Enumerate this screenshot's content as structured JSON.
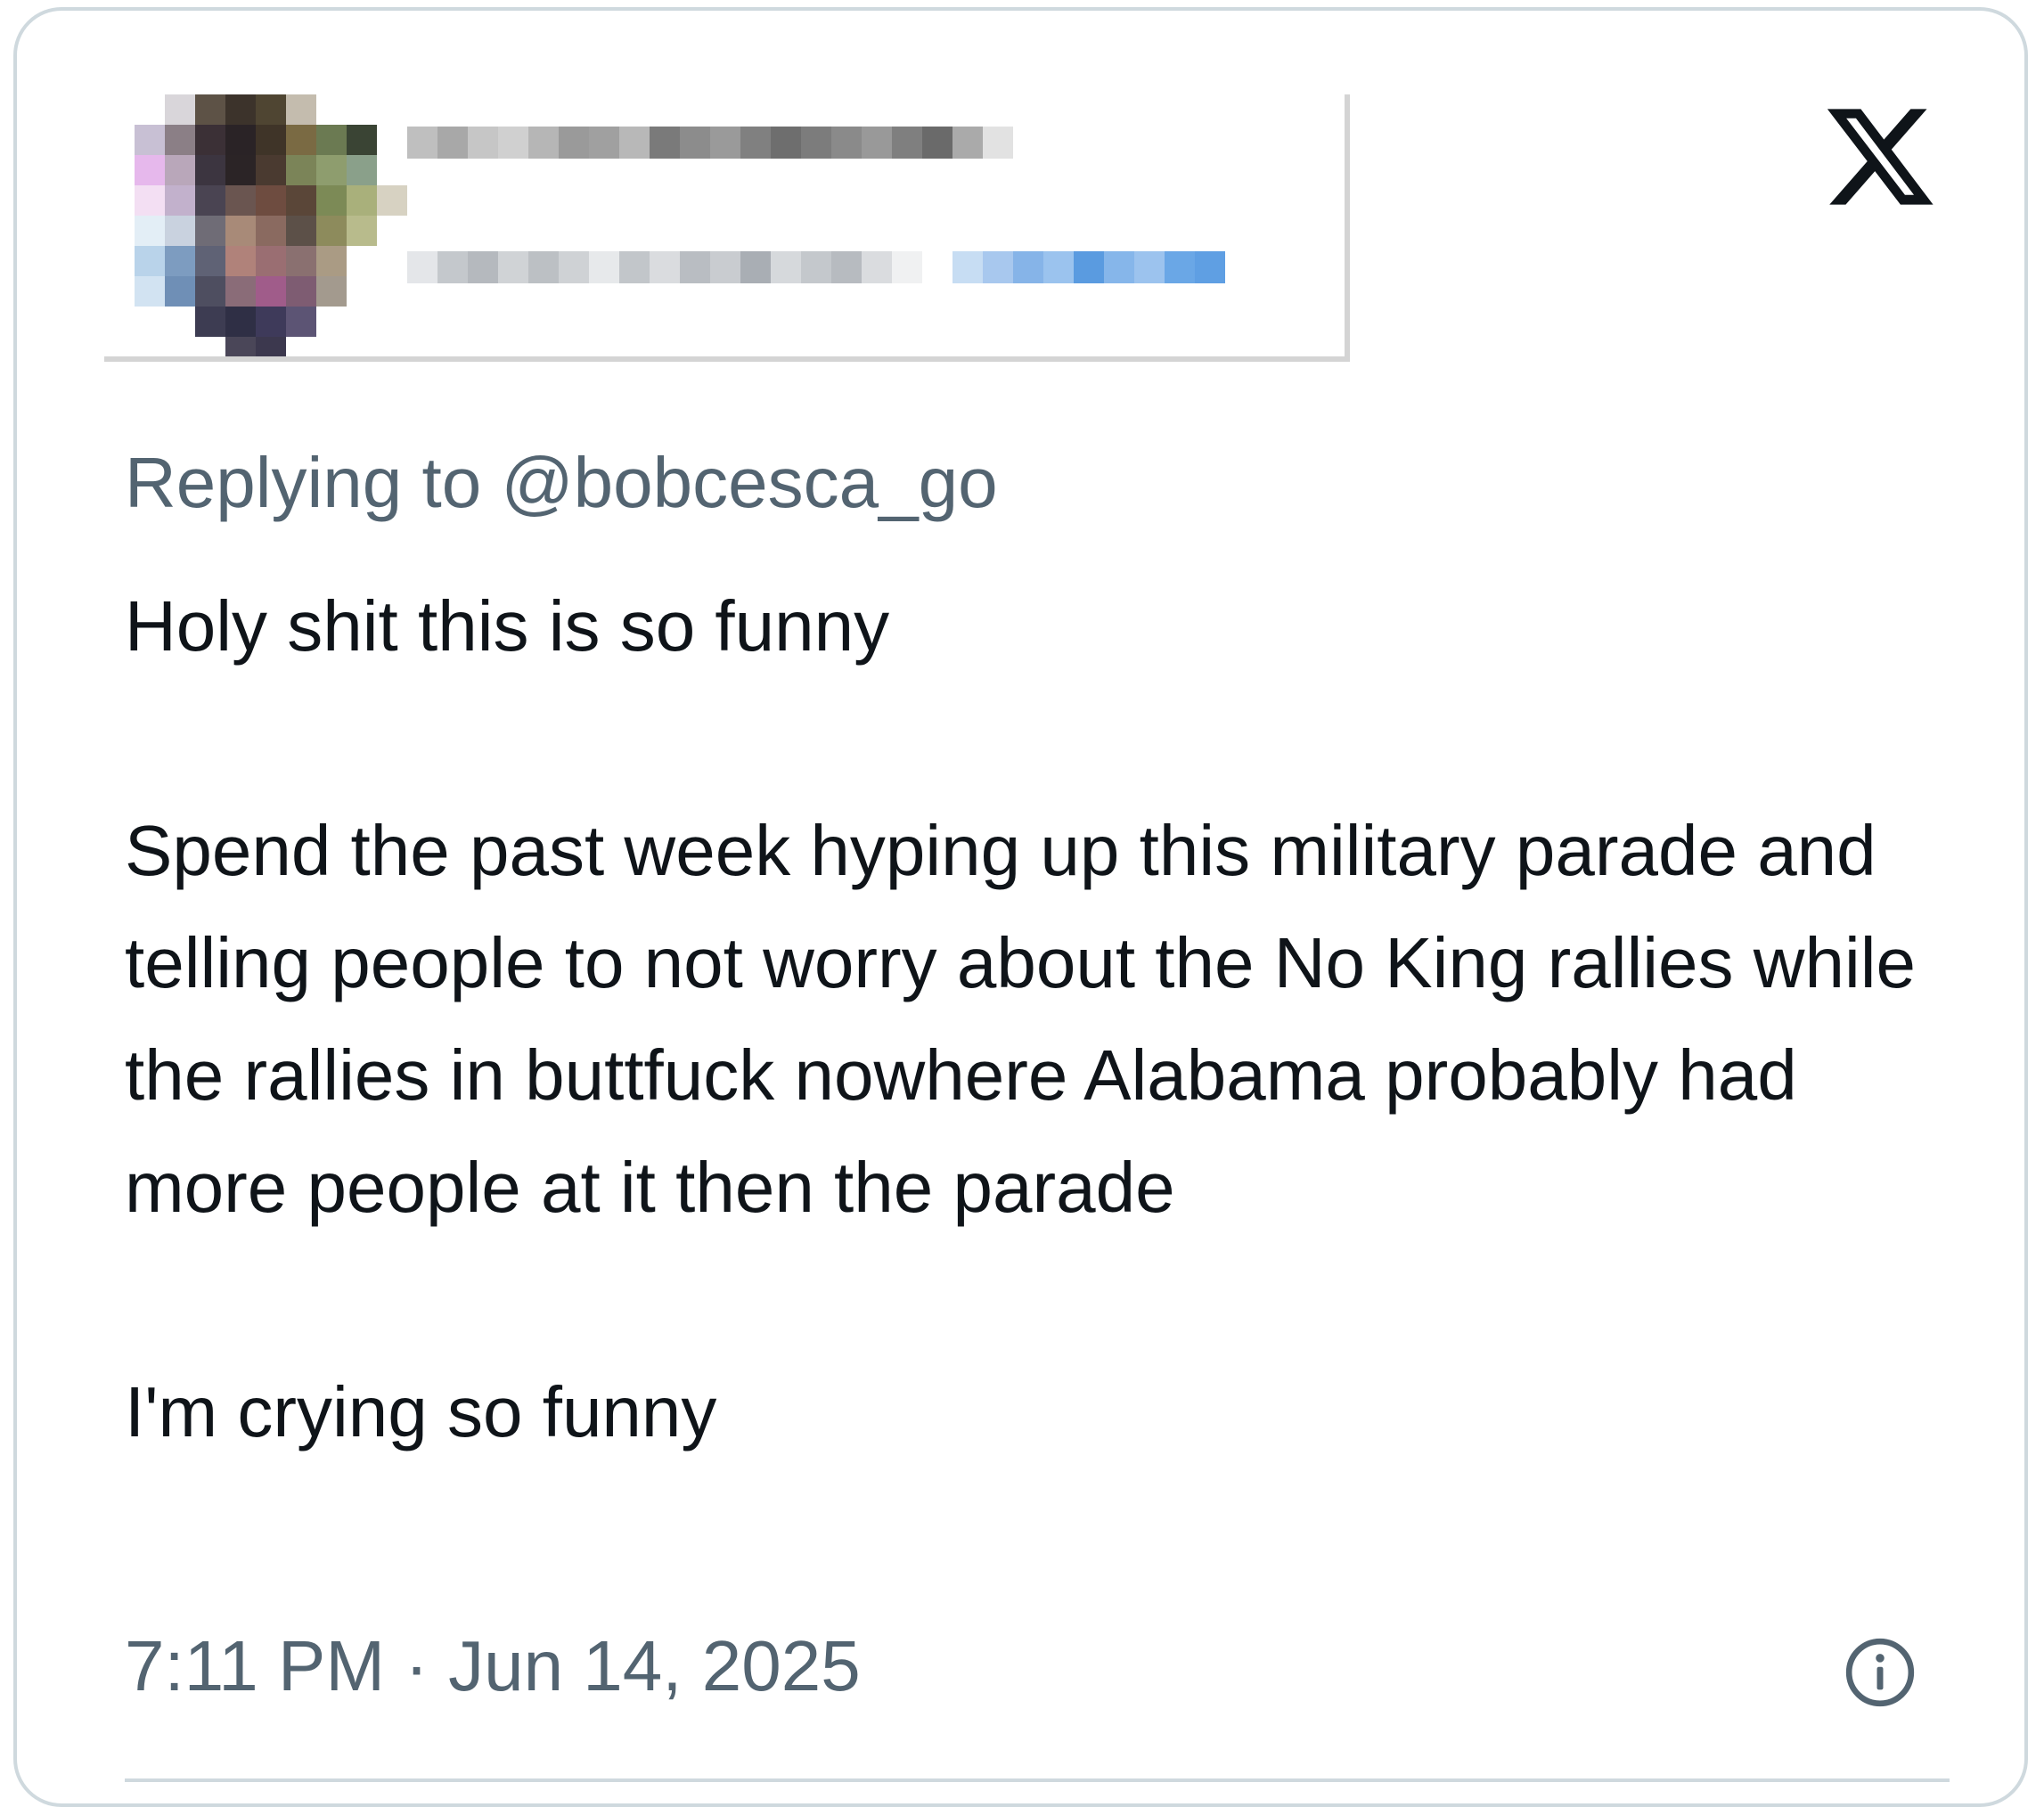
{
  "tweet": {
    "replying_to": "Replying to @bobcesca_go",
    "paragraphs": [
      "Holy shit this is so funny",
      "Spend the past week hyping up this military parade and telling people to not worry about the No King rallies while the rallies in buttfuck nowhere Alabama probably had more people at it then the parade",
      "I'm crying so funny"
    ],
    "timestamp": "7:11 PM · Jun 14, 2025"
  },
  "icons": {
    "brand": "x-logo-icon",
    "info": "info-icon"
  },
  "colors": {
    "secondary_text": "#536471",
    "primary_text": "#0f1419",
    "border": "#cfd9de",
    "link_blue": "#1d9bf0"
  }
}
